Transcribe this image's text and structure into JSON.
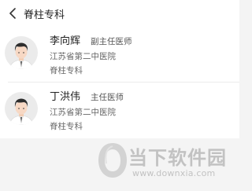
{
  "header": {
    "title": "脊柱专科",
    "back_icon": "chevron-left-icon"
  },
  "doctors": [
    {
      "name": "李向辉",
      "title": "副主任医师",
      "hospital": "江苏省第二中医院",
      "department": "脊柱专科",
      "avatar_icon": "doctor-avatar-icon"
    },
    {
      "name": "丁洪伟",
      "title": "主任医师",
      "hospital": "江苏省第二中医院",
      "department": "脊柱专科",
      "avatar_icon": "doctor-avatar-icon"
    }
  ],
  "watermark": {
    "title": "当下软件园",
    "url": "www.downxia.com"
  },
  "colors": {
    "header_bg": "#ffffff",
    "page_bg": "#f4f4f4",
    "watermark": "#c2c2c2"
  }
}
